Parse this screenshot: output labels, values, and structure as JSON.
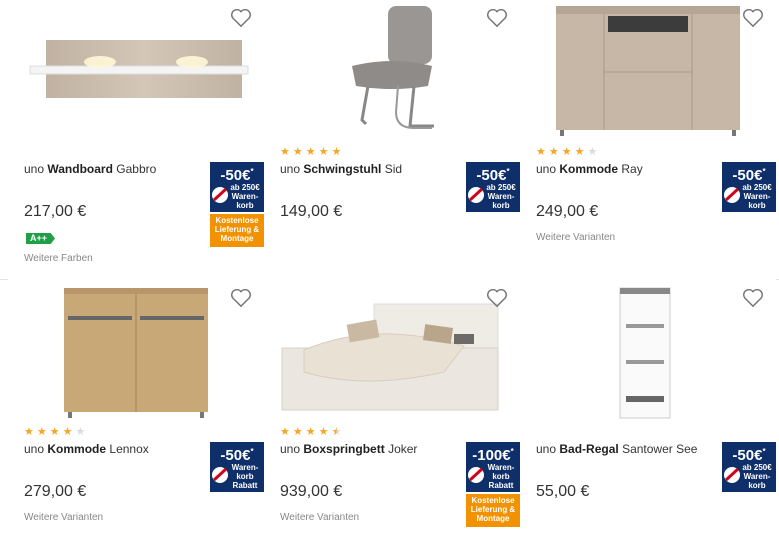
{
  "colors": {
    "accent_blue": "#0f2f6a",
    "accent_orange": "#f39200",
    "star": "#f5a623",
    "energy_green": "#1fa046"
  },
  "products": [
    {
      "name_prefix": "uno",
      "name_bold": "Wandboard",
      "name_suffix": "Gabbro",
      "price": "217,00 €",
      "rating": null,
      "badge_big": "-50€",
      "badge_small": "ab 250€ Waren-korb",
      "delivery": "Kostenlose Lieferung & Montage",
      "energy": "A++",
      "meta": "Weitere Farben"
    },
    {
      "name_prefix": "uno",
      "name_bold": "Schwingstuhl",
      "name_suffix": "Sid",
      "price": "149,00 €",
      "rating": 5,
      "badge_big": "-50€",
      "badge_small": "ab 250€ Waren-korb",
      "delivery": null,
      "energy": null,
      "meta": null
    },
    {
      "name_prefix": "uno",
      "name_bold": "Kommode",
      "name_suffix": "Ray",
      "price": "249,00 €",
      "rating": 4,
      "badge_big": "-50€",
      "badge_small": "ab 250€ Waren-korb",
      "delivery": null,
      "energy": null,
      "meta": "Weitere Varianten"
    },
    {
      "name_prefix": "uno",
      "name_bold": "Kommode",
      "name_suffix": "Lennox",
      "price": "279,00 €",
      "rating": 4,
      "badge_big": "-50€",
      "badge_small": "Waren-korb Rabatt",
      "delivery": null,
      "energy": null,
      "meta": "Weitere Varianten"
    },
    {
      "name_prefix": "uno",
      "name_bold": "Boxspringbett",
      "name_suffix": "Joker",
      "price": "939,00 €",
      "rating": 4.5,
      "badge_big": "-100€",
      "badge_small": "Waren-korb Rabatt",
      "delivery": "Kostenlose Lieferung & Montage",
      "energy": null,
      "meta": "Weitere Varianten"
    },
    {
      "name_prefix": "uno",
      "name_bold": "Bad-Regal",
      "name_suffix": "Santower See",
      "price": "55,00 €",
      "rating": null,
      "badge_big": "-50€",
      "badge_small": "ab 250€ Waren-korb",
      "delivery": null,
      "energy": null,
      "meta": null
    }
  ]
}
